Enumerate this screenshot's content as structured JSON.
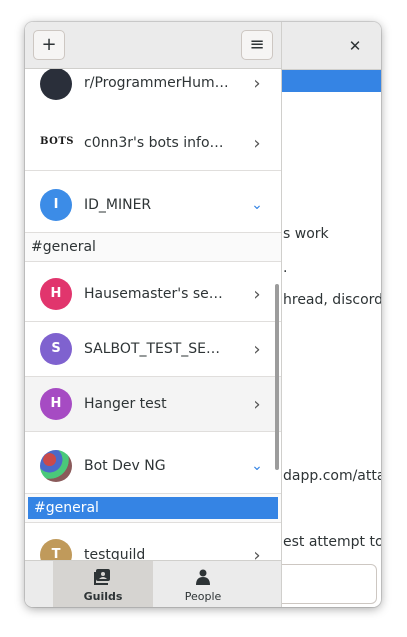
{
  "window": {
    "close_glyph": "✕"
  },
  "main": {
    "lines": [
      {
        "text": "s work"
      },
      {
        "text": "."
      },
      {
        "text": "hread, discord"
      },
      {
        "text": "dapp.com/atta"
      },
      {
        "text": "est attempt to"
      }
    ]
  },
  "header": {
    "add_glyph": "+",
    "menu_glyph": "≡"
  },
  "guilds": [
    {
      "name": "r/ProgrammerHum…",
      "avatar_letter": "",
      "avatar_color": "#2a2f3a",
      "expanded": false
    },
    {
      "name": "c0nn3r's bots info…",
      "avatar_logo": "BOTS",
      "expanded": false
    },
    {
      "name": "ID_MINER",
      "avatar_letter": "I",
      "avatar_color": "#3c8ce7",
      "expanded": true,
      "channel": "#general",
      "channel_selected": false
    },
    {
      "name": "Hausemaster's se…",
      "avatar_letter": "H",
      "avatar_color": "#e1356d",
      "expanded": false
    },
    {
      "name": "SALBOT_TEST_SE…",
      "avatar_letter": "S",
      "avatar_color": "#7f62cf",
      "expanded": false
    },
    {
      "name": "Hanger test",
      "avatar_letter": "H",
      "avatar_color": "#a64bc3",
      "expanded": false
    },
    {
      "name": "Bot Dev NG",
      "avatar_letter": "",
      "avatar_color": "#8a5a5a",
      "expanded": true,
      "channel": "#general",
      "channel_selected": true
    },
    {
      "name": "testguild",
      "avatar_letter": "T",
      "avatar_color": "#c09a5b",
      "expanded": false
    }
  ],
  "tabs": [
    {
      "label": "Guilds",
      "icon": "guilds-icon",
      "active": true
    },
    {
      "label": "People",
      "icon": "person-icon",
      "active": false
    }
  ],
  "colors": {
    "accent": "#3584e4"
  }
}
